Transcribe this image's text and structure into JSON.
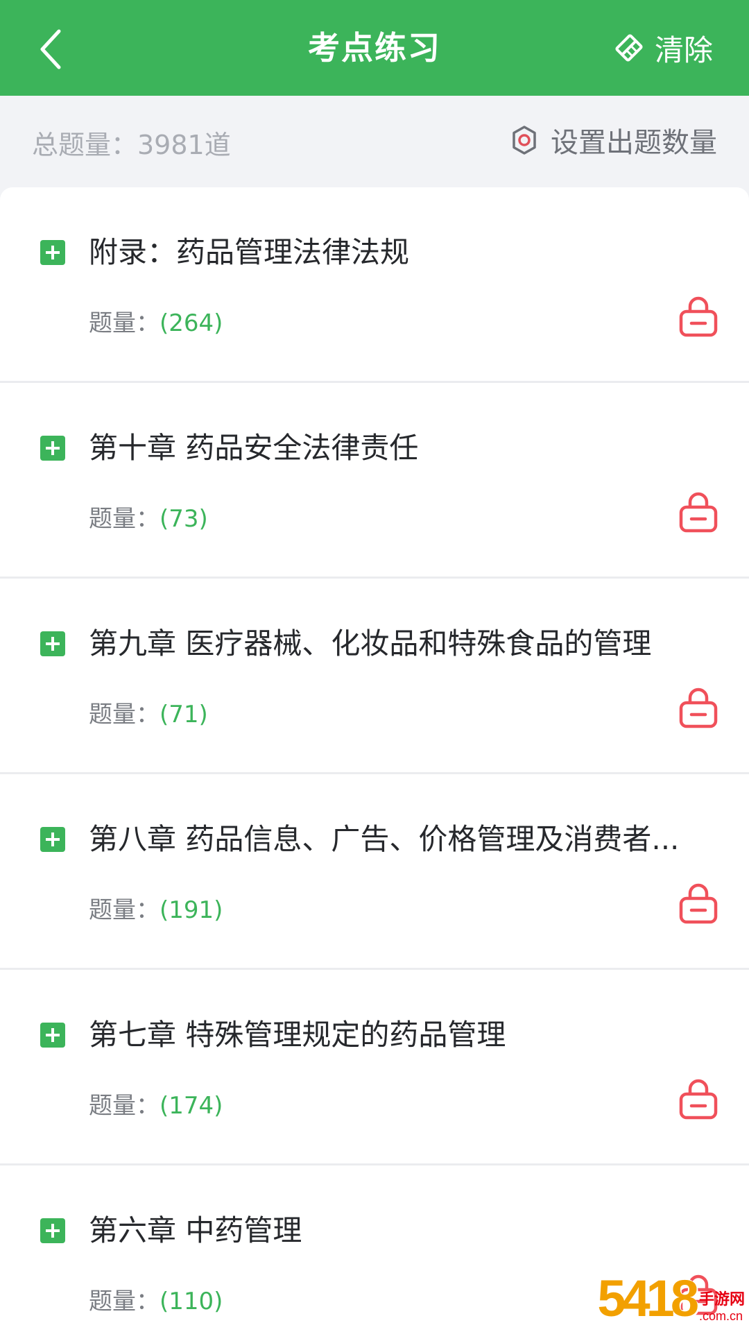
{
  "header": {
    "title": "考点练习",
    "clear_label": "清除"
  },
  "subheader": {
    "total_label": "总题量：3981道",
    "settings_label": "设置出题数量"
  },
  "items": [
    {
      "title": "附录：药品管理法律法规",
      "count_label": "题量：",
      "count": "(264)"
    },
    {
      "title": "第十章 药品安全法律责任",
      "count_label": "题量：",
      "count": "(73)"
    },
    {
      "title": "第九章 医疗器械、化妆品和特殊食品的管理",
      "count_label": "题量：",
      "count": "(71)"
    },
    {
      "title": "第八章 药品信息、广告、价格管理及消费者...",
      "count_label": "题量：",
      "count": "(191)"
    },
    {
      "title": "第七章 特殊管理规定的药品管理",
      "count_label": "题量：",
      "count": "(174)"
    },
    {
      "title": "第六章 中药管理",
      "count_label": "题量：",
      "count": "(110)"
    }
  ],
  "watermark": {
    "big": "5418",
    "line1": "手游网",
    "line2": ".com.cn"
  },
  "colors": {
    "brand_green": "#3cb45a",
    "lock_red": "#f0505a"
  },
  "icons": {
    "back": "chevron-left-icon",
    "clear": "eraser-icon",
    "settings": "gear-icon",
    "expand": "plus-square-icon",
    "lock": "lock-icon"
  }
}
